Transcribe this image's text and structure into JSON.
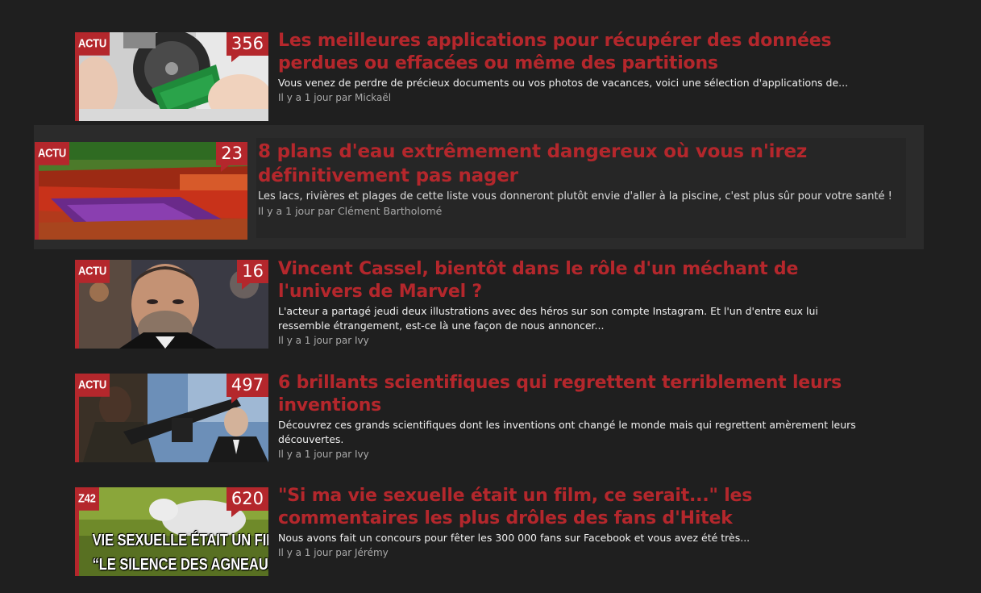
{
  "articles": [
    {
      "category": "ACTU",
      "count": "356",
      "title": "Les meilleures applications pour récupérer des données perdues ou effacées ou même des partitions",
      "excerpt": "Vous venez de perdre de précieux documents ou vos photos de vacances, voici une sélection d'applications de...",
      "date": "Il y a 1 jour",
      "by": "par",
      "author": "Mickaël",
      "image": "hard-drive-repair-photo"
    },
    {
      "category": "ACTU",
      "count": "23",
      "title": "8 plans d'eau extrêmement dangereux où vous n'irez définitivement pas nager",
      "excerpt": "Les lacs, rivières et plages de cette liste vous donneront plutôt envie d'aller à la piscine, c'est plus sûr pour votre santé !",
      "date": "Il y a 1 jour",
      "by": "par",
      "author": "Clément Bartholomé",
      "image": "red-river-photo",
      "highlighted": true
    },
    {
      "category": "ACTU",
      "count": "16",
      "title": "Vincent Cassel, bientôt dans le rôle d'un méchant de l'univers de Marvel ?",
      "excerpt": "L'acteur a partagé jeudi deux illustrations avec des héros sur son compte Instagram. Et l'un d'entre eux lui ressemble étrangement, est-ce là une façon de nous annoncer...",
      "date": "Il y a 1 jour",
      "by": "par",
      "author": "Ivy",
      "image": "actor-portrait-photo"
    },
    {
      "category": "ACTU",
      "count": "497",
      "title": "6 brillants scientifiques qui regrettent terriblement leurs inventions",
      "excerpt": "Découvrez ces grands scientifiques dont les inventions ont changé le monde mais qui regrettent amèrement leurs découvertes.",
      "date": "Il y a 1 jour",
      "by": "par",
      "author": "Ivy",
      "image": "rifle-soldiers-photo"
    },
    {
      "category": "Z42",
      "count": "620",
      "title": "\"Si ma vie sexuelle était un film, ce serait...\" les commentaires les plus drôles des fans d'Hitek",
      "excerpt": "Nous avons fait un concours pour fêter les 300 000 fans sur Facebook et vous avez été très...",
      "date": "Il y a 1 jour",
      "by": "par",
      "author": "Jérémy",
      "image": "goat-meme-photo",
      "image_caption_1": "VIE SEXUELLE ÉTAIT UN FILM CE SE",
      "image_caption_2": "“LE SILENCE DES AGNEAUX”"
    }
  ],
  "colors": {
    "background": "#1f1f1f",
    "highlight_background": "#2b2b2b",
    "accent": "#b4272c",
    "excerpt_text": "#f0f0f0",
    "meta_text": "#a9a9a9"
  }
}
